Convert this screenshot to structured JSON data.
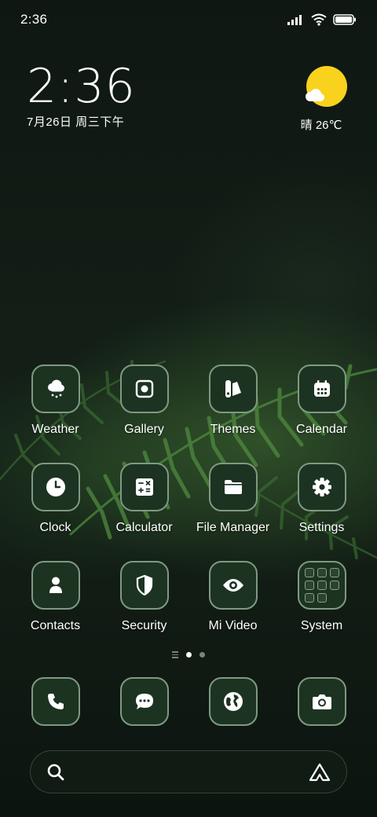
{
  "status_bar": {
    "time": "2:36"
  },
  "clock_widget": {
    "time": "2:36",
    "date": "7月26日 周三下午"
  },
  "weather_widget": {
    "condition": "晴",
    "temperature": "26℃",
    "sun_color": "#f8d21c"
  },
  "apps": [
    [
      {
        "label": "Weather",
        "icon": "cloud-snow-icon"
      },
      {
        "label": "Gallery",
        "icon": "image-icon"
      },
      {
        "label": "Themes",
        "icon": "palette-icon"
      },
      {
        "label": "Calendar",
        "icon": "calendar-icon"
      }
    ],
    [
      {
        "label": "Clock",
        "icon": "clock-icon"
      },
      {
        "label": "Calculator",
        "icon": "calculator-icon"
      },
      {
        "label": "File Manager",
        "icon": "folder-icon"
      },
      {
        "label": "Settings",
        "icon": "gear-icon"
      }
    ],
    [
      {
        "label": "Contacts",
        "icon": "person-icon"
      },
      {
        "label": "Security",
        "icon": "shield-icon"
      },
      {
        "label": "Mi Video",
        "icon": "eye-icon"
      },
      {
        "label": "System",
        "icon": "folder-grid-icon"
      }
    ]
  ],
  "page_indicator": {
    "pages": 2,
    "active": 1
  },
  "dock": [
    {
      "name": "phone",
      "icon": "phone-icon"
    },
    {
      "name": "messages",
      "icon": "chat-icon"
    },
    {
      "name": "browser",
      "icon": "globe-icon"
    },
    {
      "name": "camera",
      "icon": "camera-icon"
    }
  ],
  "search_bar": {
    "left_icon": "search-icon",
    "right_icon": "assistant-icon"
  },
  "colors": {
    "icon_bg": "#1d3322",
    "icon_border": "#7e9a82",
    "active_dot": "#ffffff"
  }
}
